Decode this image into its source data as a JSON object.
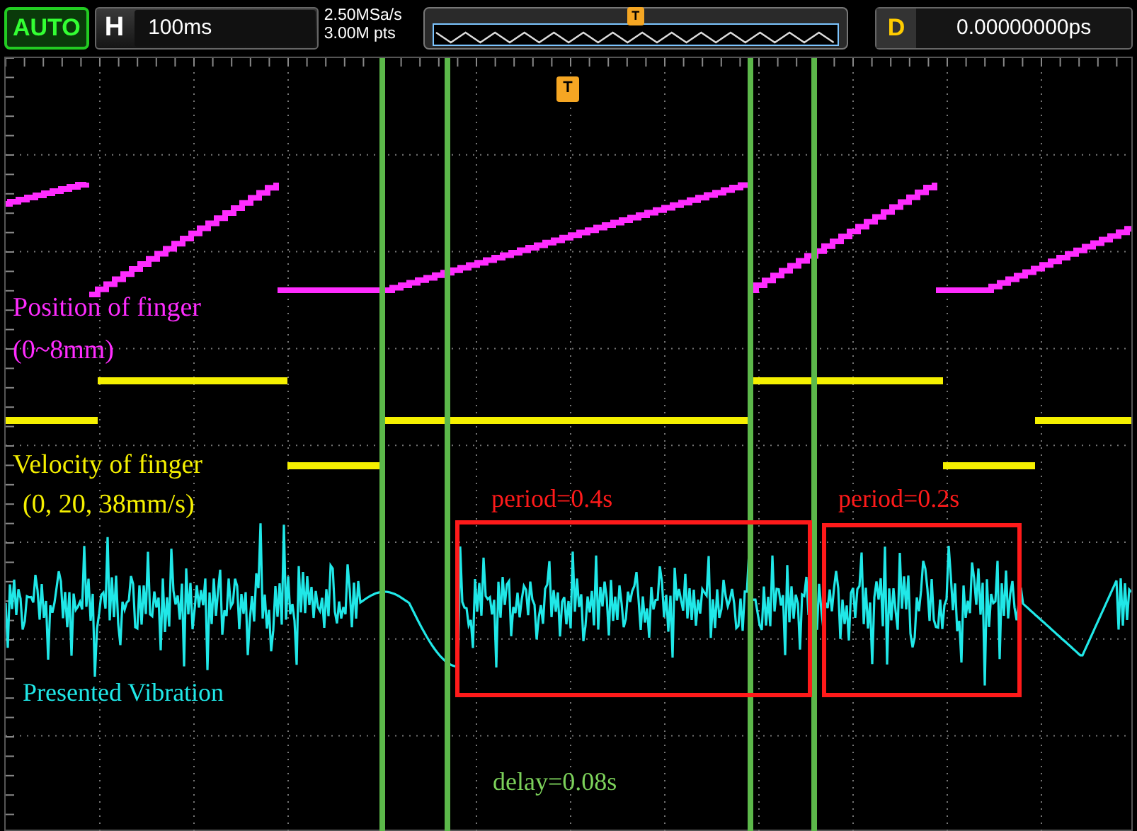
{
  "toolbar": {
    "mode_button": "AUTO",
    "timebase": {
      "label": "H",
      "value": "100ms"
    },
    "sample_rate": "2.50MSa/s",
    "memory_depth": "3.00M pts",
    "overview_trigger": "T",
    "delay": {
      "label": "D",
      "value": "0.00000000ps"
    }
  },
  "screen": {
    "trigger_marker": "T",
    "position_label": [
      "Position of finger",
      "(0~8mm)"
    ],
    "velocity_label": [
      "Velocity of finger",
      "(0, 20, 38mm/s)"
    ],
    "vibration_label": "Presented Vibration",
    "period_labels": [
      "period=0.4s",
      "period=0.2s"
    ],
    "delay_label": "delay=0.08s"
  }
}
